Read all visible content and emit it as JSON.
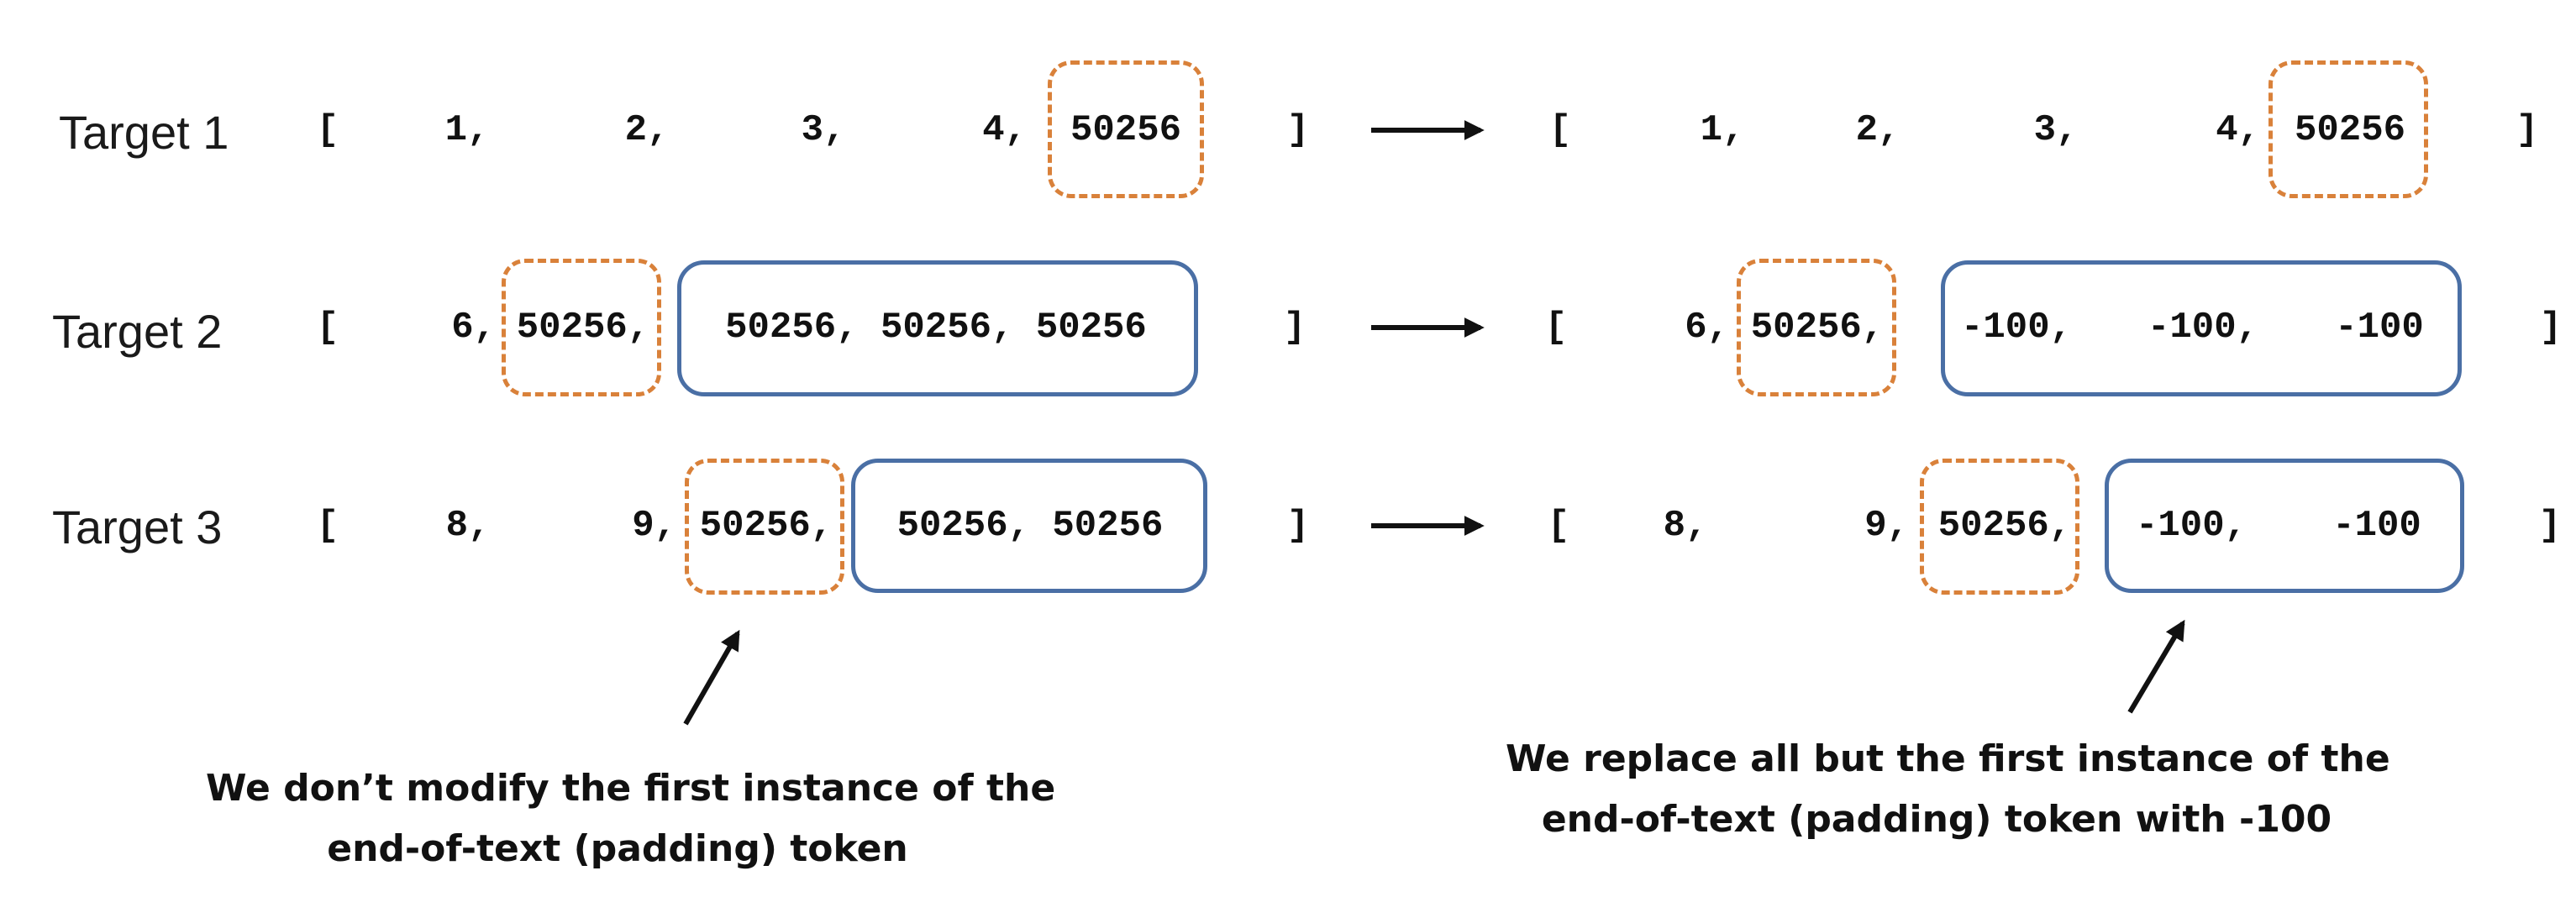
{
  "rows": [
    {
      "label": "Target 1",
      "left": {
        "open": "[",
        "close": "]",
        "tokens": [
          "1,",
          "2,",
          "3,",
          "4,",
          "50256"
        ]
      },
      "right": {
        "open": "[",
        "close": "]",
        "tokens": [
          "1,",
          "2,",
          "3,",
          "4,",
          "50256"
        ]
      }
    },
    {
      "label": "Target 2",
      "left": {
        "open": "[",
        "close": "]",
        "tokens": [
          "6,",
          "50256,",
          "50256, 50256, 50256"
        ]
      },
      "right": {
        "open": "[",
        "close": "]",
        "tokens": [
          "6,",
          "50256,",
          "-100,",
          "-100,",
          "-100"
        ]
      }
    },
    {
      "label": "Target 3",
      "left": {
        "open": "[",
        "close": "]",
        "tokens": [
          "8,",
          "9,",
          "50256,",
          "50256, 50256"
        ]
      },
      "right": {
        "open": "[",
        "close": "]",
        "tokens": [
          "8,",
          "9,",
          "50256,",
          "-100,",
          "-100"
        ]
      }
    }
  ],
  "captions": {
    "left": [
      "We don’t modify the first instance of the",
      "end-of-text (padding) token"
    ],
    "right": [
      "We replace all but the first instance of the",
      "end-of-text (padding) token with -100"
    ]
  },
  "colors": {
    "first_pad_box": "#d9813a",
    "replaced_box": "#4a6fa5",
    "arrow": "#111111"
  }
}
